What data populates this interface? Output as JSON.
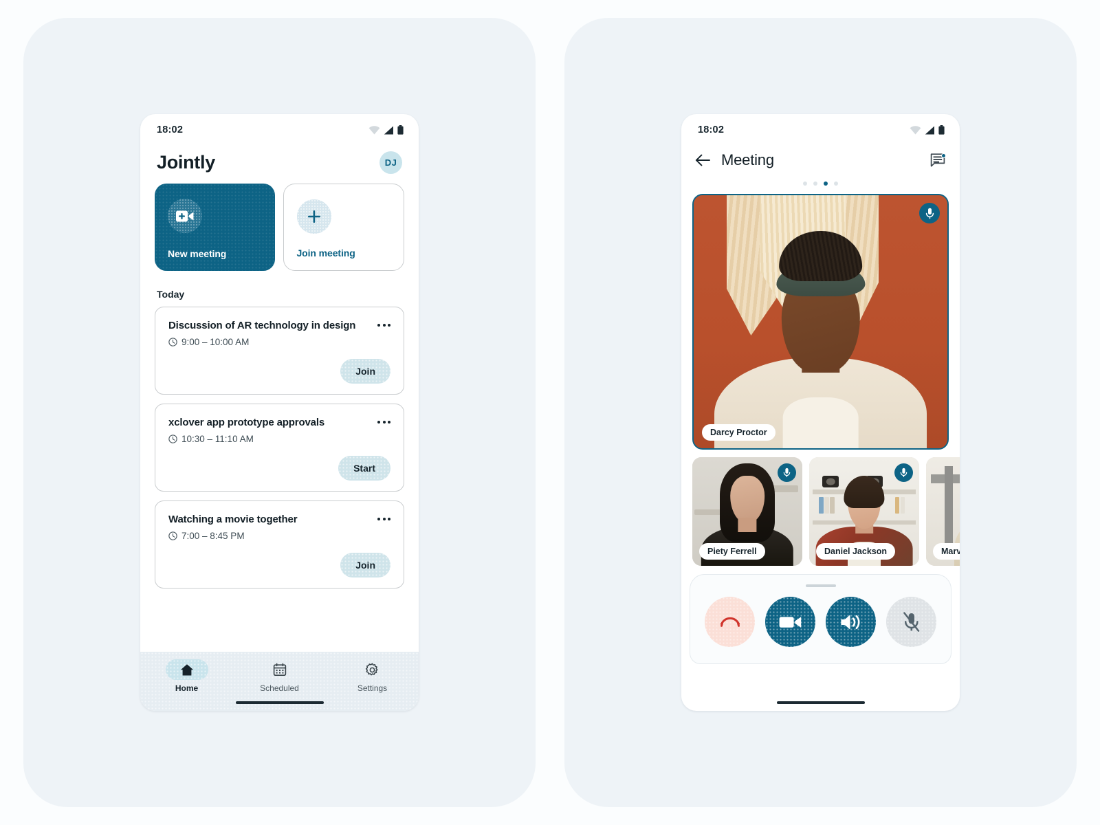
{
  "screen_home": {
    "status_bar": {
      "time": "18:02",
      "icons": [
        "wifi-icon",
        "signal-icon",
        "battery-icon"
      ]
    },
    "app_title": "Jointly",
    "avatar_initials": "DJ",
    "actions": [
      {
        "label": "New meeting",
        "icon": "video-plus-icon",
        "style": "primary"
      },
      {
        "label": "Join meeting",
        "icon": "plus-icon",
        "style": "outline"
      }
    ],
    "section_title": "Today",
    "meetings": [
      {
        "title": "Discussion of AR technology in design",
        "time": "9:00 – 10:00 AM",
        "action_label": "Join"
      },
      {
        "title": "xclover app prototype approvals",
        "time": "10:30 – 11:10 AM",
        "action_label": "Start"
      },
      {
        "title": "Watching a movie together",
        "time": "7:00 – 8:45 PM",
        "action_label": "Join"
      }
    ],
    "bottom_nav": [
      {
        "label": "Home",
        "icon": "home-icon",
        "active": true
      },
      {
        "label": "Scheduled",
        "icon": "calendar-icon",
        "active": false
      },
      {
        "label": "Settings",
        "icon": "gear-icon",
        "active": false
      }
    ]
  },
  "screen_meeting": {
    "status_bar": {
      "time": "18:02",
      "icons": [
        "wifi-icon",
        "signal-icon",
        "battery-icon"
      ]
    },
    "back_icon": "arrow-left-icon",
    "title": "Meeting",
    "chat_icon": "chat-icon",
    "chat_badge": true,
    "page_dots": {
      "count": 4,
      "active_index": 2
    },
    "main_participant": {
      "name": "Darcy Proctor",
      "mic": "mic-on-icon"
    },
    "thumbnails": [
      {
        "name": "Piety Ferrell",
        "mic": "mic-on-icon"
      },
      {
        "name": "Daniel Jackson",
        "mic": "mic-on-icon"
      },
      {
        "name": "Marv",
        "mic": "mic-on-icon"
      }
    ],
    "controls": [
      {
        "name": "end-call",
        "icon": "phone-hangup-icon",
        "style": "end"
      },
      {
        "name": "camera",
        "icon": "video-icon",
        "style": "teal"
      },
      {
        "name": "speaker",
        "icon": "speaker-icon",
        "style": "teal"
      },
      {
        "name": "microphone",
        "icon": "mic-off-icon",
        "style": "gray"
      }
    ]
  },
  "colors": {
    "brand_teal": "#0d6385",
    "accent_light": "#cfe4ea",
    "panel_bg": "#eef3f7",
    "page_bg": "#fbfdfe",
    "end_call_bg": "#fbdfd7",
    "end_call_fg": "#d0342c",
    "text_dark": "#131f26"
  }
}
